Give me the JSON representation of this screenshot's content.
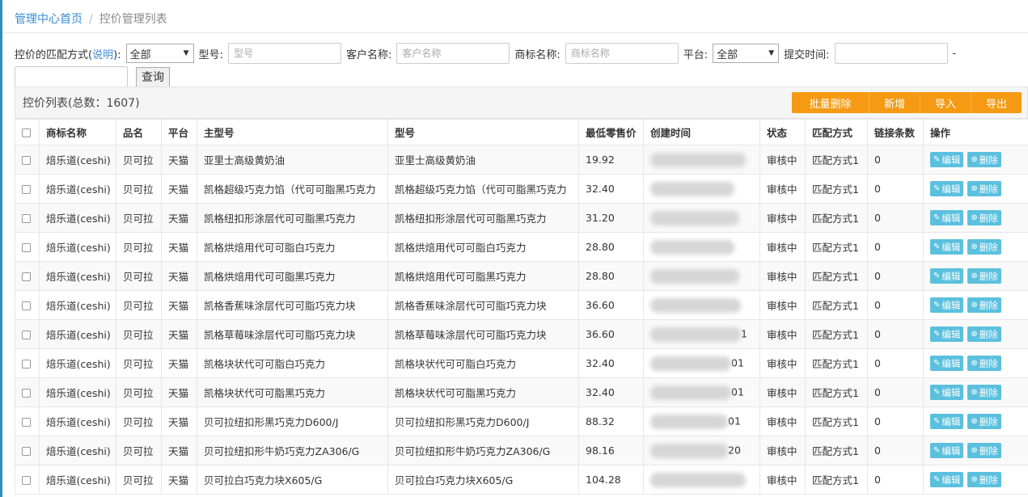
{
  "breadcrumb": {
    "home": "管理中心首页",
    "separator": "/",
    "current": "控价管理列表"
  },
  "filters": {
    "match_label": "控价的匹配方式(",
    "match_link": "说明",
    "match_label_end": "):",
    "match_value": "全部",
    "model_label": "型号:",
    "model_placeholder": "型号",
    "customer_label": "客户名称:",
    "customer_placeholder": "客户名称",
    "brand_label": "商标名称:",
    "brand_placeholder": "商标名称",
    "platform_label": "平台:",
    "platform_value": "全部",
    "time_label": "提交时间:",
    "time_sep": "-",
    "query_label": "查询"
  },
  "panel": {
    "title": "控价列表(总数：1607)",
    "buttons": [
      "批量删除",
      "新增",
      "导入",
      "导出"
    ]
  },
  "table": {
    "headers": [
      "",
      "商标名称",
      "品名",
      "平台",
      "主型号",
      "型号",
      "最低零售价",
      "创建时间",
      "状态",
      "匹配方式",
      "链接条数",
      "操作"
    ],
    "edit_label": "编辑",
    "delete_label": "删除",
    "rows": [
      [
        "焙乐道(ceshi)",
        "贝可拉",
        "天猫",
        "亚里士高级黄奶油",
        "亚里士高级黄奶油",
        "19.92",
        "",
        "审核中",
        "匹配方式1",
        "0"
      ],
      [
        "焙乐道(ceshi)",
        "贝可拉",
        "天猫",
        "凯格超级巧克力馅（代可可脂黑巧克力",
        "凯格超级巧克力馅（代可可脂黑巧克力",
        "32.40",
        "",
        "审核中",
        "匹配方式1",
        "0"
      ],
      [
        "焙乐道(ceshi)",
        "贝可拉",
        "天猫",
        "凯格纽扣形涂层代可可脂黑巧克力",
        "凯格纽扣形涂层代可可脂黑巧克力",
        "31.20",
        "",
        "审核中",
        "匹配方式1",
        "0"
      ],
      [
        "焙乐道(ceshi)",
        "贝可拉",
        "天猫",
        "凯格烘焙用代可可脂白巧克力",
        "凯格烘焙用代可可脂白巧克力",
        "28.80",
        "",
        "审核中",
        "匹配方式1",
        "0"
      ],
      [
        "焙乐道(ceshi)",
        "贝可拉",
        "天猫",
        "凯格烘焙用代可可脂黑巧克力",
        "凯格烘焙用代可可脂黑巧克力",
        "28.80",
        "",
        "审核中",
        "匹配方式1",
        "0"
      ],
      [
        "焙乐道(ceshi)",
        "贝可拉",
        "天猫",
        "凯格香蕉味涂层代可可脂巧克力块",
        "凯格香蕉味涂层代可可脂巧克力块",
        "36.60",
        "",
        "审核中",
        "匹配方式1",
        "0"
      ],
      [
        "焙乐道(ceshi)",
        "贝可拉",
        "天猫",
        "凯格草莓味涂层代可可脂巧克力块",
        "凯格草莓味涂层代可可脂巧克力块",
        "36.60",
        "1",
        "审核中",
        "匹配方式1",
        "0"
      ],
      [
        "焙乐道(ceshi)",
        "贝可拉",
        "天猫",
        "凯格块状代可可脂白巧克力",
        "凯格块状代可可脂白巧克力",
        "32.40",
        "01",
        "审核中",
        "匹配方式1",
        "0"
      ],
      [
        "焙乐道(ceshi)",
        "贝可拉",
        "天猫",
        "凯格块状代可可脂黑巧克力",
        "凯格块状代可可脂黑巧克力",
        "32.40",
        "01",
        "审核中",
        "匹配方式1",
        "0"
      ],
      [
        "焙乐道(ceshi)",
        "贝可拉",
        "天猫",
        "贝可拉纽扣形黑巧克力D600/J",
        "贝可拉纽扣形黑巧克力D600/J",
        "88.32",
        "01",
        "审核中",
        "匹配方式1",
        "0"
      ],
      [
        "焙乐道(ceshi)",
        "贝可拉",
        "天猫",
        "贝可拉纽扣形牛奶巧克力ZA306/G",
        "贝可拉纽扣形牛奶巧克力ZA306/G",
        "98.16",
        "20",
        "审核中",
        "匹配方式1",
        "0"
      ],
      [
        "焙乐道(ceshi)",
        "贝可拉",
        "天猫",
        "贝可拉白巧克力块X605/G",
        "贝可拉白巧克力块X605/G",
        "104.28",
        "",
        "审核中",
        "匹配方式1",
        "0"
      ]
    ]
  }
}
